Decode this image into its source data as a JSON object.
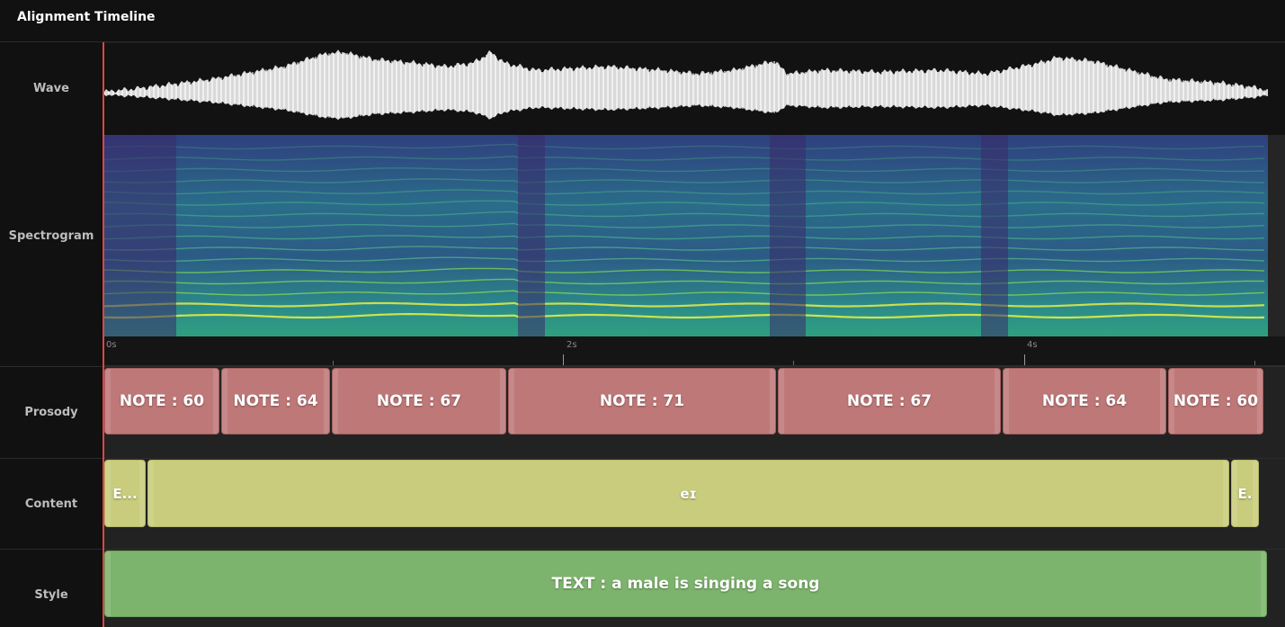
{
  "header": {
    "title": "Alignment Timeline"
  },
  "rows": {
    "wave": "Wave",
    "spectrogram": "Spectrogram",
    "prosody": "Prosody",
    "content": "Content",
    "style": "Style"
  },
  "ruler": {
    "ticks": [
      "0s",
      "2s",
      "4s"
    ]
  },
  "prosody": [
    {
      "label": "NOTE : 60"
    },
    {
      "label": "NOTE : 64"
    },
    {
      "label": "NOTE : 67"
    },
    {
      "label": "NOTE : 71"
    },
    {
      "label": "NOTE : 67"
    },
    {
      "label": "NOTE : 64"
    },
    {
      "label": "NOTE : 60"
    }
  ],
  "content": [
    {
      "label": "E..."
    },
    {
      "label": "eɪ"
    },
    {
      "label": "E."
    }
  ],
  "style": [
    {
      "label": "TEXT : a male is singing a song"
    }
  ],
  "colors": {
    "playhead": "#e04444",
    "note": "#bf7878",
    "phoneme": "#c8cc7c",
    "style": "#7db46d"
  }
}
